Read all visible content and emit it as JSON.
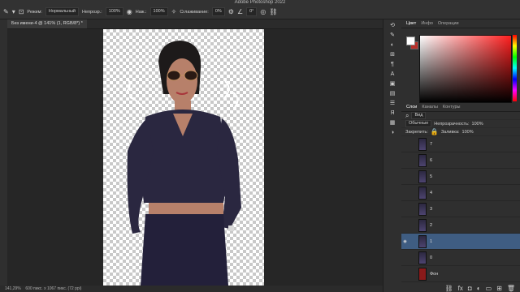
{
  "app": {
    "title": "Adobe Photoshop 2022"
  },
  "options_bar": {
    "mode_label": "Режим:",
    "mode_value": "Нормальный",
    "opacity_label": "Непрозр.:",
    "opacity_value": "100%",
    "pressure_label": "Наж.:",
    "pressure_value": "100%",
    "smoothing_label": "Сглаживание:",
    "smoothing_value": "0%",
    "angle_value": "0°"
  },
  "document": {
    "tab_title": "Без имени-4 @ 141% (1, RGB/8*) *"
  },
  "status": {
    "zoom": "141,29%",
    "info": "600 пикс. x 1067 пикс. (72 ppi)"
  },
  "panels": {
    "top_tabs": [
      "Цвет",
      "Инфо",
      "Операции"
    ],
    "layer_tabs": [
      "Слои",
      "Каналы",
      "Контуры"
    ]
  },
  "layers_panel": {
    "filter_label": "Вид",
    "blend_mode": "Обычные",
    "opacity_label": "Непрозрачность:",
    "opacity_value": "100%",
    "lock_label": "Закрепить:",
    "fill_label": "Заливка:",
    "fill_value": "100%",
    "layers": [
      {
        "name": "7",
        "visible": false,
        "selected": false
      },
      {
        "name": "6",
        "visible": false,
        "selected": false
      },
      {
        "name": "5",
        "visible": false,
        "selected": false
      },
      {
        "name": "4",
        "visible": false,
        "selected": false
      },
      {
        "name": "3",
        "visible": false,
        "selected": false
      },
      {
        "name": "2",
        "visible": false,
        "selected": false
      },
      {
        "name": "1",
        "visible": true,
        "selected": true
      },
      {
        "name": "0",
        "visible": false,
        "selected": false
      },
      {
        "name": "Фон",
        "visible": false,
        "selected": false
      }
    ]
  },
  "colors": {
    "accent": "#3f5d82",
    "foreground": "#ffffff",
    "background": "#b8302a"
  }
}
